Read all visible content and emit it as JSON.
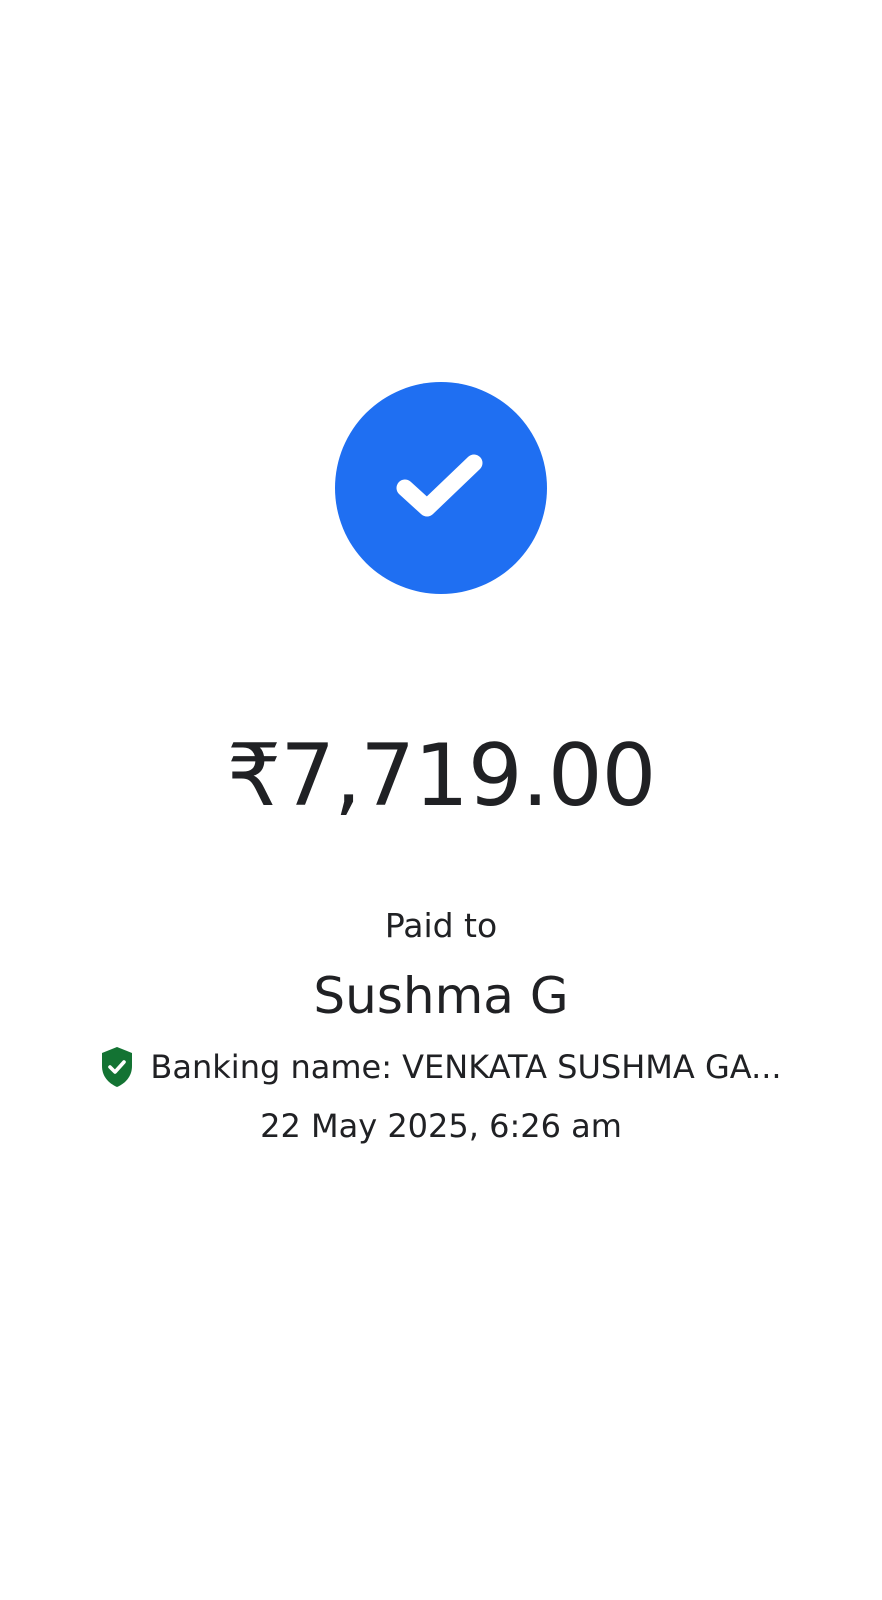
{
  "status": {
    "icon": "checkmark-icon",
    "color": "#1f6ff2"
  },
  "payment": {
    "amount": "₹7,719.00",
    "paid_label": "Paid to",
    "payee_name": "Sushma G",
    "banking_name": "Banking name: VENKATA SUSHMA GA...",
    "verified_icon": "verified-shield-icon",
    "verified_color": "#137333",
    "datetime": "22 May 2025, 6:26 am"
  }
}
